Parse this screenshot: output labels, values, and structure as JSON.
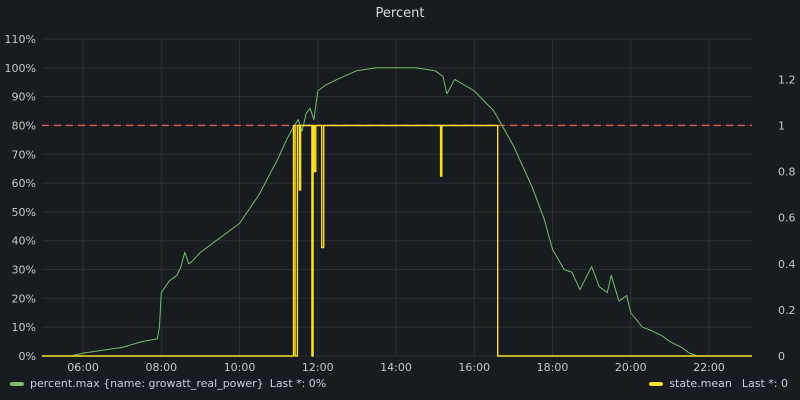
{
  "panel": {
    "title": "Percent"
  },
  "colors": {
    "background": "#181b1f",
    "grid": "#2c2f34",
    "series1": "#73bf69",
    "series2": "#fade2a",
    "threshold": "#e05a5a"
  },
  "legend": {
    "left": {
      "name": "percent.max {name: growatt_real_power}",
      "last": "Last *: 0%"
    },
    "right": {
      "name": "state.mean",
      "last": "Last *: 0"
    }
  },
  "chart_data": {
    "type": "line",
    "title": "Percent",
    "x_ticks": [
      "06:00",
      "08:00",
      "10:00",
      "12:00",
      "14:00",
      "16:00",
      "18:00",
      "20:00",
      "22:00"
    ],
    "y_left_ticks": [
      "0%",
      "10%",
      "20%",
      "30%",
      "40%",
      "50%",
      "60%",
      "70%",
      "80%",
      "90%",
      "100%",
      "110%"
    ],
    "y_right_ticks": [
      "0",
      "0.2",
      "0.4",
      "0.6",
      "0.8",
      "1",
      "1.2"
    ],
    "y_left_range": [
      0,
      110
    ],
    "y_right_range": [
      0,
      1.375
    ],
    "x_range_hours": [
      4.95,
      23.1
    ],
    "threshold": {
      "axis": "left",
      "value": 80,
      "style": "dashed"
    },
    "grid": true,
    "legend_position": "bottom",
    "series": [
      {
        "name": "percent.max {name: growatt_real_power}",
        "axis": "left",
        "x_hours": [
          4.95,
          5.7,
          6.0,
          6.5,
          7.0,
          7.5,
          7.9,
          7.95,
          8.0,
          8.2,
          8.4,
          8.5,
          8.6,
          8.7,
          8.8,
          9.0,
          9.5,
          10.0,
          10.5,
          11.0,
          11.2,
          11.4,
          11.5,
          11.6,
          11.7,
          11.8,
          11.9,
          12.0,
          12.2,
          12.5,
          13.0,
          13.5,
          14.0,
          14.5,
          15.0,
          15.2,
          15.3,
          15.5,
          16.0,
          16.5,
          17.0,
          17.5,
          17.8,
          18.0,
          18.3,
          18.5,
          18.7,
          19.0,
          19.2,
          19.4,
          19.5,
          19.7,
          19.9,
          20.0,
          20.3,
          20.5,
          20.8,
          21.0,
          21.3,
          21.5,
          21.7,
          22.0,
          23.1
        ],
        "values": [
          0,
          0,
          1,
          2,
          3,
          5,
          6,
          10,
          22,
          26,
          28,
          31,
          36,
          32,
          33,
          36,
          41,
          46,
          56,
          69,
          75,
          80,
          82,
          78,
          84,
          86,
          82,
          92,
          94,
          96,
          99,
          100,
          100,
          100,
          99,
          97,
          91,
          96,
          92,
          85,
          73,
          58,
          47,
          37,
          30,
          29,
          23,
          31,
          24,
          22,
          28,
          19,
          21,
          15,
          10,
          9,
          7,
          5,
          3,
          1,
          0,
          0,
          0
        ]
      },
      {
        "name": "state.mean",
        "axis": "right",
        "x_hours": [
          4.95,
          11.38,
          11.38,
          11.42,
          11.42,
          11.48,
          11.48,
          11.53,
          11.53,
          11.56,
          11.56,
          11.58,
          11.58,
          11.85,
          11.85,
          11.88,
          11.88,
          11.91,
          11.91,
          11.95,
          11.95,
          12.1,
          12.1,
          12.15,
          12.15,
          12.2,
          12.2,
          15.14,
          15.14,
          15.17,
          15.17,
          15.22,
          15.22,
          16.6,
          16.6,
          23.1
        ],
        "values": [
          0,
          0,
          1,
          1,
          0,
          0,
          1,
          1,
          0.72,
          0.72,
          1,
          1,
          1,
          1,
          0,
          0,
          1,
          1,
          0.8,
          0.8,
          1,
          1,
          0.47,
          0.47,
          1,
          1,
          1,
          1,
          0.78,
          0.78,
          1,
          1,
          1,
          1,
          0,
          0
        ]
      }
    ]
  }
}
